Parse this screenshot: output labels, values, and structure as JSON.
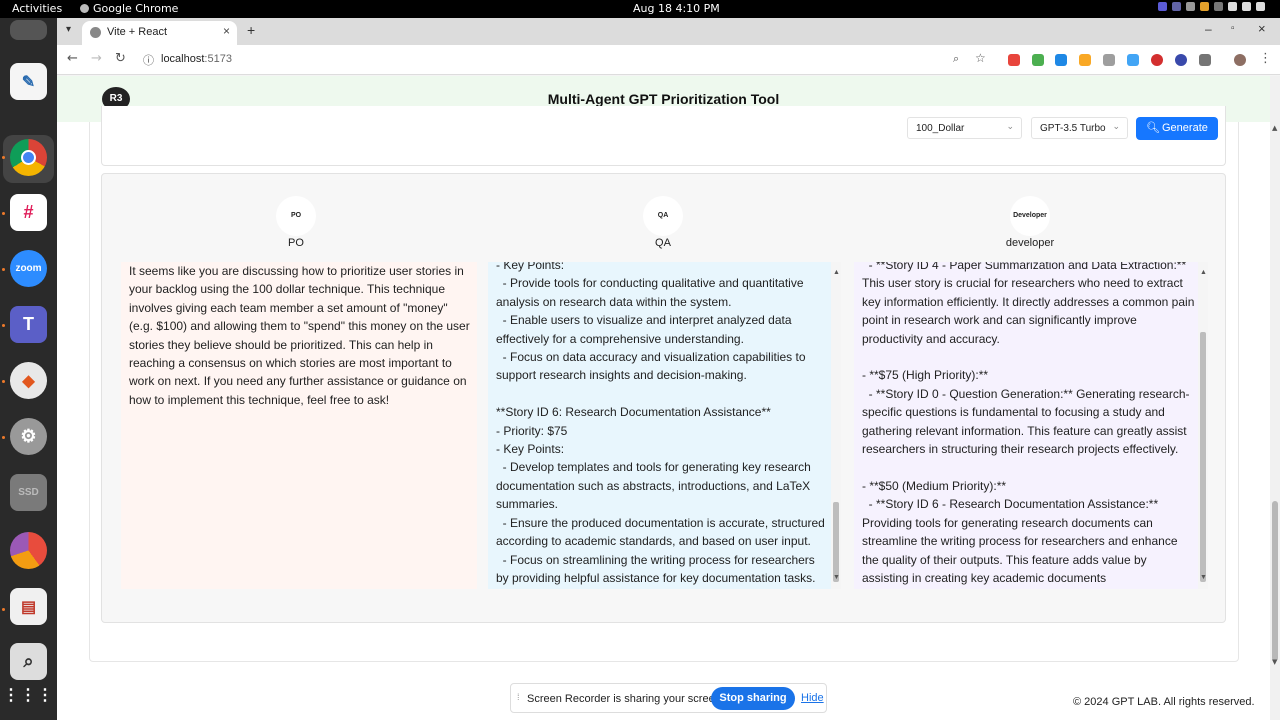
{
  "system": {
    "activities": "Activities",
    "app_name": "Google Chrome",
    "clock": "Aug 18  4:10 PM"
  },
  "browser": {
    "tab_title": "Vite + React",
    "url_host": "localhost",
    "url_port": ":5173"
  },
  "app": {
    "logo_text": "R3",
    "title": "Multi-Agent GPT Prioritization Tool"
  },
  "controls": {
    "technique": "100_Dollar",
    "model": "GPT-3.5 Turbo",
    "generate_label": "Generate"
  },
  "agents": [
    {
      "avatar": "PO",
      "name": "PO",
      "text": "It seems like you are discussing how to prioritize user stories in\nyour backlog using the 100 dollar technique. This technique\ninvolves giving each team member a set amount of \"money\"\n(e.g. $100) and allowing them to \"spend\" this money on the user\nstories they believe should be prioritized. This can help in\nreaching a consensus on which stories are most important to\nwork on next. If you need any further assistance or guidance on\nhow to implement this technique, feel free to ask!"
    },
    {
      "avatar": "QA",
      "name": "QA",
      "text": "- Key Points:\n  - Provide tools for conducting qualitative and quantitative\nanalysis on research data within the system.\n  - Enable users to visualize and interpret analyzed data\neffectively for a comprehensive understanding.\n  - Focus on data accuracy and visualization capabilities to\nsupport research insights and decision-making.\n\n**Story ID 6: Research Documentation Assistance**\n- Priority: $75\n- Key Points:\n  - Develop templates and tools for generating key research\ndocumentation such as abstracts, introductions, and LaTeX\nsummaries.\n  - Ensure the produced documentation is accurate, structured\naccording to academic standards, and based on user input.\n  - Focus on streamlining the writing process for researchers\nby providing helpful assistance for key documentation tasks."
    },
    {
      "avatar": "Developer",
      "name": "developer",
      "text": "  - **Story ID 4 - Paper Summarization and Data Extraction:**\nThis user story is crucial for researchers who need to extract\nkey information efficiently. It directly addresses a common pain\npoint in research work and can significantly improve\nproductivity and accuracy.\n\n- **$75 (High Priority):**\n  - **Story ID 0 - Question Generation:** Generating research-\nspecific questions is fundamental to focusing a study and\ngathering relevant information. This feature can greatly assist\nresearchers in structuring their research projects effectively.\n\n- **$50 (Medium Priority):**\n  - **Story ID 6 - Research Documentation Assistance:**\nProviding tools for generating research documents can\nstreamline the writing process for researchers and enhance\nthe quality of their outputs. This feature adds value by\nassisting in creating key academic documents"
    }
  ],
  "sharing": {
    "message": "Screen Recorder is sharing your screen.",
    "stop_label": "Stop sharing",
    "hide_label": "Hide"
  },
  "footer": "© 2024 GPT LAB. All rights reserved."
}
